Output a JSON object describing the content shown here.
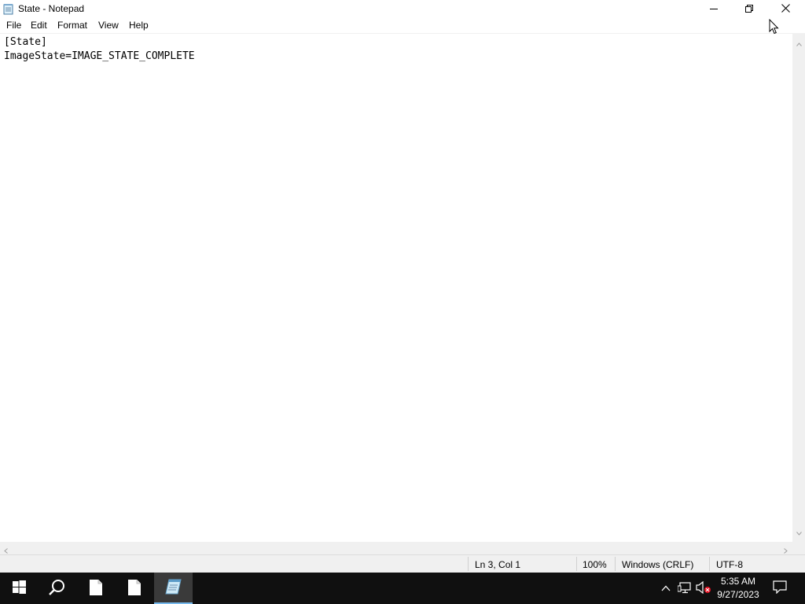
{
  "window": {
    "title": "State - Notepad",
    "icon": "notepad-icon"
  },
  "menu": {
    "items": [
      "File",
      "Edit",
      "Format",
      "View",
      "Help"
    ]
  },
  "editor": {
    "lines": [
      "[State]",
      "ImageState=IMAGE_STATE_COMPLETE"
    ]
  },
  "status": {
    "position": "Ln 3, Col 1",
    "zoom": "100%",
    "line_endings": "Windows (CRLF)",
    "encoding": "UTF-8"
  },
  "taskbar": {
    "items": [
      "start-icon",
      "search-icon",
      "file-icon",
      "file-icon",
      "notepad-icon"
    ],
    "active_item": "notepad-icon",
    "accent_color": "#76b9ed",
    "clock_time": "5:35 AM",
    "clock_date": "9/27/2023"
  },
  "tray": {
    "icons": [
      "chevron-up-icon",
      "network-icon",
      "volume-muted-icon",
      "notification-icon"
    ]
  }
}
